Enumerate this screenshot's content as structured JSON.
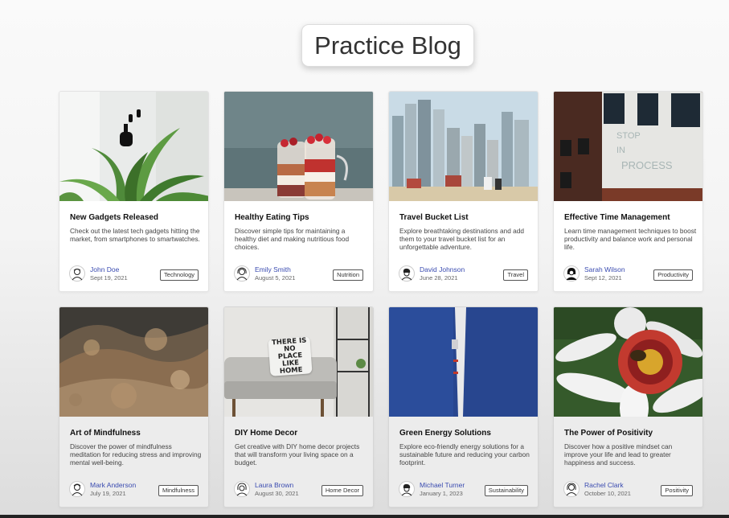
{
  "page": {
    "title": "Practice Blog"
  },
  "posts": [
    {
      "title": "New Gadgets Released",
      "description": "Check out the latest tech gadgets hitting the market, from smartphones to smartwatches.",
      "author": "John Doe",
      "date": "Sept 19, 2021",
      "tag": "Technology",
      "image_icon": "earbuds-plant-image"
    },
    {
      "title": "Healthy Eating Tips",
      "description": "Discover simple tips for maintaining a healthy diet and making nutritious food choices.",
      "author": "Emily Smith",
      "date": "August 5, 2021",
      "tag": "Nutrition",
      "image_icon": "parfait-jars-image"
    },
    {
      "title": "Travel Bucket List",
      "description": "Explore breathtaking destinations and add them to your travel bucket list for an unforgettable adventure.",
      "author": "David Johnson",
      "date": "June 28, 2021",
      "tag": "Travel",
      "image_icon": "city-skyline-image"
    },
    {
      "title": "Effective Time Management",
      "description": "Learn time management techniques to boost productivity and balance work and personal life.",
      "author": "Sarah Wilson",
      "date": "Sept 12, 2021",
      "tag": "Productivity",
      "image_icon": "brick-building-image"
    },
    {
      "title": "Art of Mindfulness",
      "description": "Discover the power of mindfulness meditation for reducing stress and improving mental well-being.",
      "author": "Mark Anderson",
      "date": "July 19, 2021",
      "tag": "Mindfulness",
      "image_icon": "water-splash-image"
    },
    {
      "title": "DIY Home Decor",
      "description": "Get creative with DIY home decor projects that will transform your living space on a budget.",
      "author": "Laura Brown",
      "date": "August 30, 2021",
      "tag": "Home Decor",
      "image_icon": "sofa-pillow-image"
    },
    {
      "title": "Green Energy Solutions",
      "description": "Explore eco-friendly energy solutions for a sustainable future and reducing your carbon footprint.",
      "author": "Michael Turner",
      "date": "January 1, 2023",
      "tag": "Sustainability",
      "image_icon": "wind-turbine-image"
    },
    {
      "title": "The Power of Positivity",
      "description": "Discover how a positive mindset can improve your life and lead to greater happiness and success.",
      "author": "Rachel Clark",
      "date": "October 10, 2021",
      "tag": "Positivity",
      "image_icon": "flower-bee-image"
    }
  ],
  "pillow_text": "THERE IS NO PLACE LIKE HOME",
  "colors": {
    "author_link": "#3a4bb0",
    "background_top": "#fafafa",
    "background_bottom": "#dcdcdc"
  }
}
